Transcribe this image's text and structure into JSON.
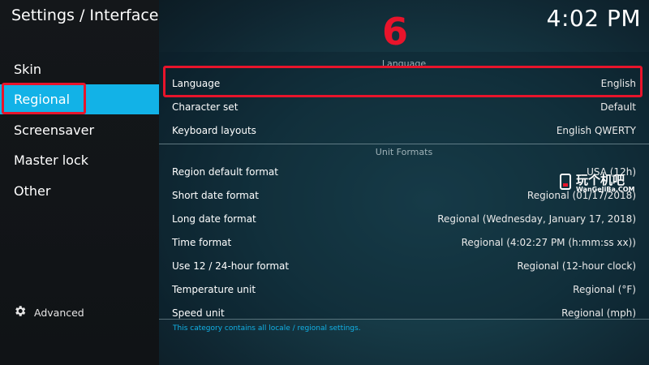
{
  "header": {
    "title": "Settings / Interface",
    "clock": "4:02 PM"
  },
  "annotation": {
    "number": "6"
  },
  "sidebar": {
    "items": [
      {
        "label": "Skin"
      },
      {
        "label": "Regional"
      },
      {
        "label": "Screensaver"
      },
      {
        "label": "Master lock"
      },
      {
        "label": "Other"
      }
    ],
    "advanced_label": "Advanced"
  },
  "sections": {
    "language": "Language",
    "unit_formats": "Unit Formats"
  },
  "settings": [
    {
      "label": "Language",
      "value": "English"
    },
    {
      "label": "Character set",
      "value": "Default"
    },
    {
      "label": "Keyboard layouts",
      "value": "English QWERTY"
    },
    {
      "label": "Region default format",
      "value": "USA (12h)"
    },
    {
      "label": "Short date format",
      "value": "Regional (01/17/2018)"
    },
    {
      "label": "Long date format",
      "value": "Regional (Wednesday, January 17, 2018)"
    },
    {
      "label": "Time format",
      "value": "Regional (4:02:27 PM (h:mm:ss xx))"
    },
    {
      "label": "Use 12 / 24-hour format",
      "value": "Regional (12-hour clock)"
    },
    {
      "label": "Temperature unit",
      "value": "Regional (°F)"
    },
    {
      "label": "Speed unit",
      "value": "Regional (mph)"
    }
  ],
  "help_text": "This category contains all locale / regional settings.",
  "watermark": {
    "text": "玩个机吧",
    "sub": "WanGeJiBa.COM"
  }
}
